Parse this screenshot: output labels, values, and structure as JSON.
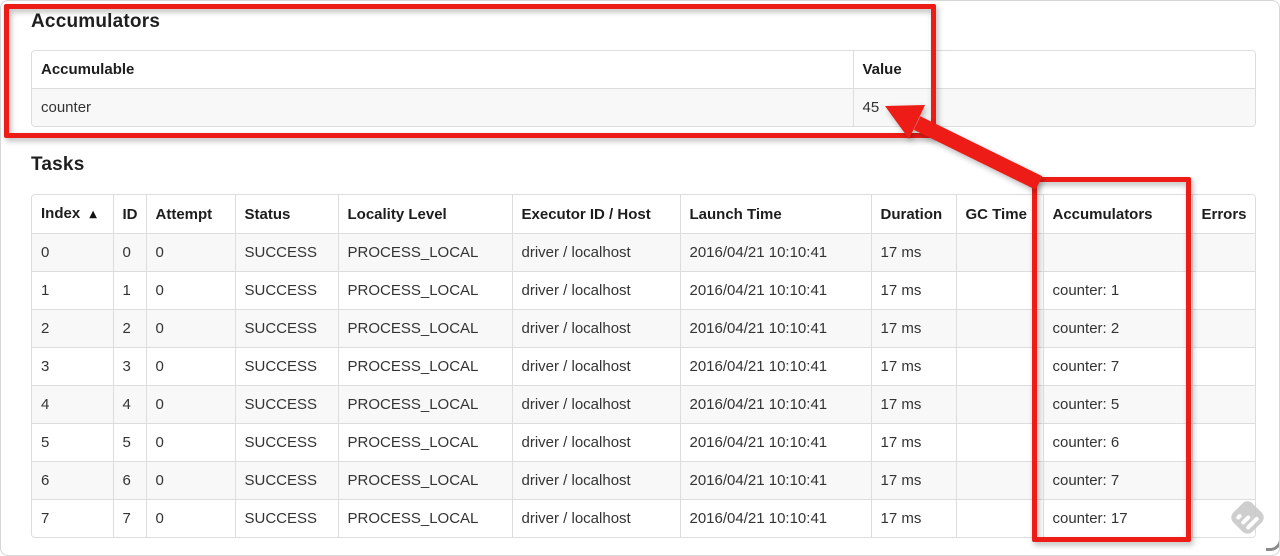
{
  "annotation": {
    "color": "#ed1c16",
    "shapes": [
      "box-around-accumulators-section",
      "box-around-accumulators-column",
      "arrow-to-value-45"
    ]
  },
  "accumulators_section": {
    "title": "Accumulators",
    "table": {
      "headers": [
        "Accumulable",
        "Value"
      ],
      "rows": [
        [
          "counter",
          "45"
        ]
      ]
    }
  },
  "tasks_section": {
    "title": "Tasks",
    "table": {
      "headers": [
        "Index",
        "ID",
        "Attempt",
        "Status",
        "Locality Level",
        "Executor ID / Host",
        "Launch Time",
        "Duration",
        "GC Time",
        "Accumulators",
        "Errors"
      ],
      "sort": {
        "column": "Index",
        "direction": "ascending",
        "icon": "▲"
      },
      "rows": [
        [
          "0",
          "0",
          "0",
          "SUCCESS",
          "PROCESS_LOCAL",
          "driver / localhost",
          "2016/04/21 10:10:41",
          "17 ms",
          "",
          "",
          ""
        ],
        [
          "1",
          "1",
          "0",
          "SUCCESS",
          "PROCESS_LOCAL",
          "driver / localhost",
          "2016/04/21 10:10:41",
          "17 ms",
          "",
          "counter: 1",
          ""
        ],
        [
          "2",
          "2",
          "0",
          "SUCCESS",
          "PROCESS_LOCAL",
          "driver / localhost",
          "2016/04/21 10:10:41",
          "17 ms",
          "",
          "counter: 2",
          ""
        ],
        [
          "3",
          "3",
          "0",
          "SUCCESS",
          "PROCESS_LOCAL",
          "driver / localhost",
          "2016/04/21 10:10:41",
          "17 ms",
          "",
          "counter: 7",
          ""
        ],
        [
          "4",
          "4",
          "0",
          "SUCCESS",
          "PROCESS_LOCAL",
          "driver / localhost",
          "2016/04/21 10:10:41",
          "17 ms",
          "",
          "counter: 5",
          ""
        ],
        [
          "5",
          "5",
          "0",
          "SUCCESS",
          "PROCESS_LOCAL",
          "driver / localhost",
          "2016/04/21 10:10:41",
          "17 ms",
          "",
          "counter: 6",
          ""
        ],
        [
          "6",
          "6",
          "0",
          "SUCCESS",
          "PROCESS_LOCAL",
          "driver / localhost",
          "2016/04/21 10:10:41",
          "17 ms",
          "",
          "counter: 7",
          ""
        ],
        [
          "7",
          "7",
          "0",
          "SUCCESS",
          "PROCESS_LOCAL",
          "driver / localhost",
          "2016/04/21 10:10:41",
          "17 ms",
          "",
          "counter: 17",
          ""
        ]
      ]
    }
  },
  "icons": {
    "sort_ascending": "▲",
    "watermark": "diamond-stripes"
  }
}
